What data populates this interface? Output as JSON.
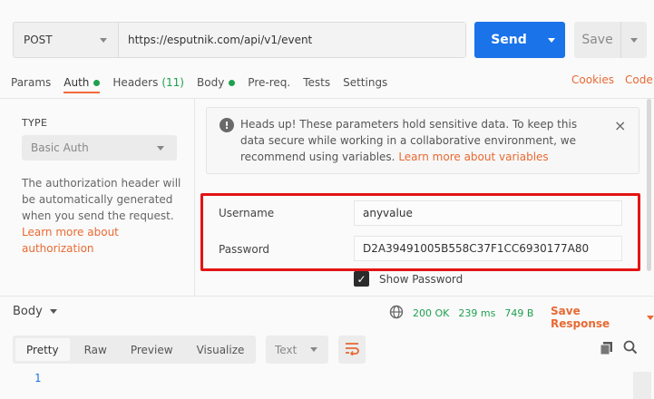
{
  "request": {
    "method": "POST",
    "url": "https://esputnik.com/api/v1/event",
    "send_label": "Send",
    "save_label": "Save"
  },
  "tabs": [
    {
      "label": "Params"
    },
    {
      "label": "Auth",
      "dot": true,
      "active": true
    },
    {
      "label": "Headers",
      "count": "(11)"
    },
    {
      "label": "Body",
      "dot": true
    },
    {
      "label": "Pre-req."
    },
    {
      "label": "Tests"
    },
    {
      "label": "Settings"
    }
  ],
  "tab_links": {
    "cookies": "Cookies",
    "code": "Code"
  },
  "auth": {
    "type_label": "TYPE",
    "type_value": "Basic Auth",
    "description": "The authorization header will be automatically generated when you send the request.",
    "learn_more": "Learn more about authorization"
  },
  "alert": {
    "icon": "!",
    "text": "Heads up! These parameters hold sensitive data. To keep this data secure while working in a collaborative environment, we recommend using variables.",
    "link": "Learn more about variables",
    "close": "×"
  },
  "fields": {
    "username_label": "Username",
    "username_value": "anyvalue",
    "password_label": "Password",
    "password_value": "D2A39491005B558C37F1CC6930177A80",
    "show_password": "Show Password",
    "show_password_checked": true
  },
  "response": {
    "body_label": "Body",
    "status": "200 OK",
    "time": "239 ms",
    "size": "749 B",
    "save_response": "Save Response",
    "view_tabs": [
      "Pretty",
      "Raw",
      "Preview",
      "Visualize"
    ],
    "active_view": "Pretty",
    "format": "Text",
    "line_numbers": [
      "1"
    ]
  },
  "colors": {
    "accent": "#f26b3a",
    "send": "#1a73e8",
    "status_ok": "#1ea050",
    "highlight": "#e31414"
  }
}
